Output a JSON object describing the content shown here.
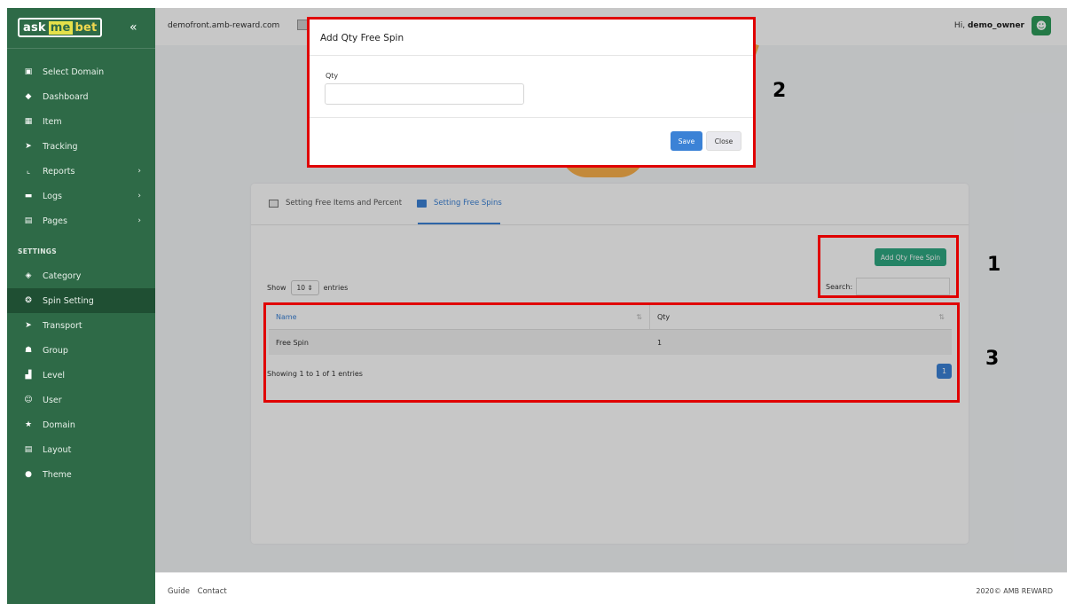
{
  "sidebar": {
    "logo": {
      "w1": "ask",
      "w2": "me",
      "w3": "bet"
    },
    "collapse_icon": "«",
    "items_main": [
      {
        "label": "Select Domain",
        "icon": "▣"
      },
      {
        "label": "Dashboard",
        "icon": "◆"
      },
      {
        "label": "Item",
        "icon": "▦"
      },
      {
        "label": "Tracking",
        "icon": "➤"
      },
      {
        "label": "Reports",
        "icon": "⌞",
        "chevron": "›"
      },
      {
        "label": "Logs",
        "icon": "▬",
        "chevron": "›"
      },
      {
        "label": "Pages",
        "icon": "▤",
        "chevron": "›"
      }
    ],
    "settings_label": "SETTINGS",
    "items_settings": [
      {
        "label": "Category",
        "icon": "◈"
      },
      {
        "label": "Spin Setting",
        "icon": "❂"
      },
      {
        "label": "Transport",
        "icon": "➤"
      },
      {
        "label": "Group",
        "icon": "☗"
      },
      {
        "label": "Level",
        "icon": "▟"
      },
      {
        "label": "User",
        "icon": "☺"
      },
      {
        "label": "Domain",
        "icon": "★"
      },
      {
        "label": "Layout",
        "icon": "▤"
      },
      {
        "label": "Theme",
        "icon": "●"
      }
    ]
  },
  "topbar": {
    "domain": "demofront.amb-reward.com",
    "greeting_prefix": "Hi,",
    "username": "demo_owner"
  },
  "tabs": [
    {
      "label": "Setting Free Items and Percent"
    },
    {
      "label": "Setting Free Spins"
    }
  ],
  "toolbar": {
    "add_button": "Add Qty Free Spin",
    "show_label": "Show",
    "show_value": "10 ⇕",
    "entries_label": "entries",
    "search_label": "Search:"
  },
  "table": {
    "headers": [
      "Name",
      "Qty"
    ],
    "rows": [
      {
        "name": "Free Spin",
        "qty": "1"
      }
    ],
    "info": "Showing 1 to 1 of 1 entries",
    "page": "1"
  },
  "footer": {
    "guide": "Guide",
    "contact": "Contact",
    "copyright": "2020© AMB REWARD"
  },
  "modal": {
    "title": "Add Qty Free Spin",
    "qty_label": "Qty",
    "qty_value": "",
    "save": "Save",
    "close": "Close"
  },
  "annotations": {
    "n1": "1",
    "n2": "2",
    "n3": "3"
  },
  "colors": {
    "sidebar_bg": "#2e6a47",
    "accent_blue": "#3b82d6",
    "add_button": "#2fa882",
    "annotation_red": "#e00000"
  }
}
